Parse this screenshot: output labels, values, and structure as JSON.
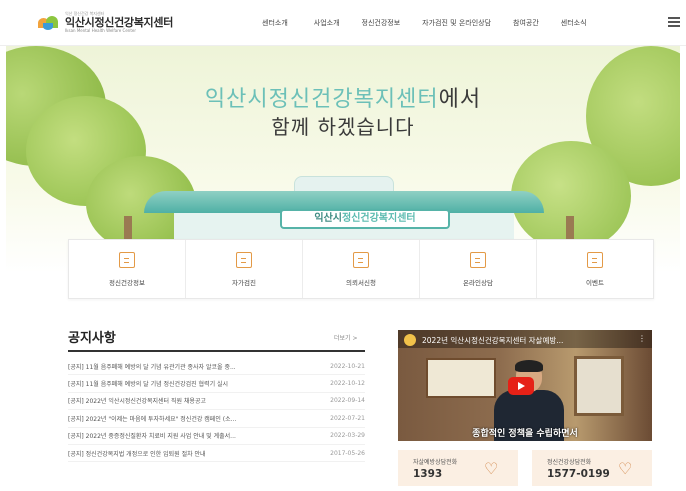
{
  "header": {
    "logo_tag": "익산 정신건강 복지센터",
    "logo_title": "익산시정신건강복지센터",
    "logo_subtitle": "Iksan Mental Health Welfare Center",
    "nav": [
      "센터소개",
      "사업소개",
      "정신건강정보",
      "자가검진 및 온라인상담",
      "참여공간",
      "센터소식"
    ],
    "menu_icon": "hamburger-icon"
  },
  "hero": {
    "highlight": "익산시정신건강복지센터",
    "line1_suffix": "에서",
    "line2": "함께 하겠습니다",
    "sign_part1": "익산시",
    "sign_part2": "정신건강복지센터"
  },
  "quick_menu": [
    {
      "label": "정신건강정보",
      "icon": "clipboard-icon"
    },
    {
      "label": "자가검진",
      "icon": "monitor-icon"
    },
    {
      "label": "의뢰서신청",
      "icon": "document-icon"
    },
    {
      "label": "온라인상담",
      "icon": "chat-icon"
    },
    {
      "label": "이벤트",
      "icon": "calendar-icon"
    }
  ],
  "notice": {
    "title": "공지사항",
    "more": "더보기 >",
    "items": [
      {
        "text": "[공지] 11월 음주폐해 예방의 달 기념 유관기관 종사자 알코올 중...",
        "date": "2022-10-21"
      },
      {
        "text": "[공지] 11월 음주폐해 예방의 달 기념 정신건강검진 협력기 실시",
        "date": "2022-10-12"
      },
      {
        "text": "[공지] 2022년 익산시정신건강복지센터 직원 채용공고",
        "date": "2022-09-14"
      },
      {
        "text": "[공지] 2022년 \"이제는 마음에 투자하세요\" 정신건강 캠페인 (소...",
        "date": "2022-07-21"
      },
      {
        "text": "[공지] 2022년 중증정신질환자 치료비 지원 사업 안내 및 계출서...",
        "date": "2022-03-29"
      },
      {
        "text": "[공지] 정신건강복지법 개정으로 인한 입퇴원 절차 안내",
        "date": "2017-05-26"
      }
    ]
  },
  "video": {
    "caption": "2022년 익산시정신건강복지센터 자살예방...",
    "subtitle": "종합적인 정책을 수립하면서"
  },
  "hotlines": [
    {
      "label": "자살예방상담전화",
      "number": "1393"
    },
    {
      "label": "정신건강상담전화",
      "number": "1577-0199"
    }
  ],
  "colors": {
    "accent_teal": "#6cc0b8",
    "icon_orange": "#e39a47",
    "hotline_bg": "#fbefe3"
  }
}
